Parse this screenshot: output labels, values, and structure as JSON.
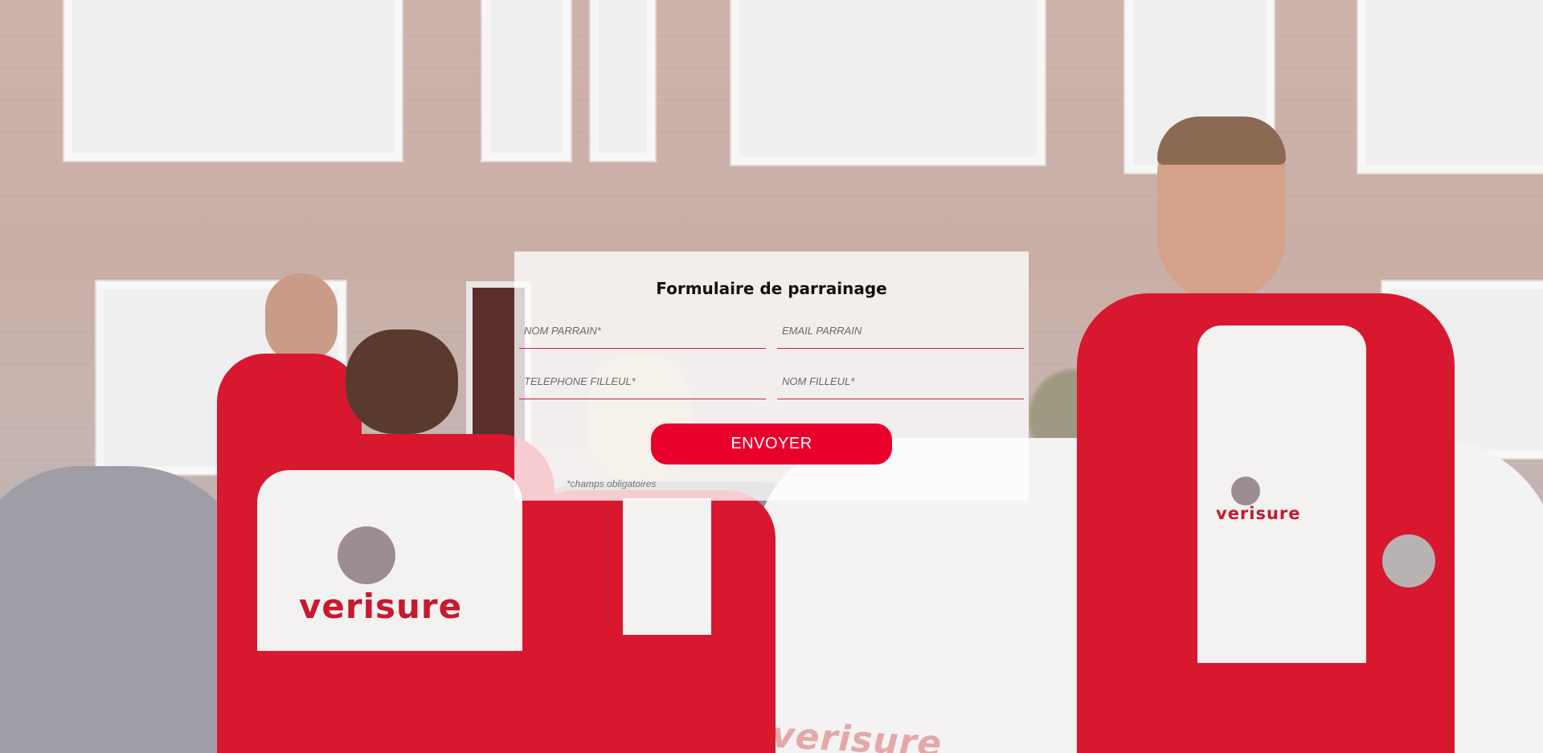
{
  "form": {
    "title": "Formulaire de parrainage",
    "fields": {
      "nom_parrain": {
        "placeholder": "NOM PARRAIN*",
        "value": ""
      },
      "email_parrain": {
        "placeholder": "EMAIL PARRAIN",
        "value": ""
      },
      "telephone_filleul": {
        "placeholder": "TELEPHONE FILLEUL*",
        "value": ""
      },
      "nom_filleul": {
        "placeholder": "NOM FILLEUL*",
        "value": ""
      }
    },
    "submit_label": "ENVOYER",
    "required_note": "*champs obligatoires"
  },
  "background": {
    "brand_texts": [
      "verisure",
      "verisure",
      "verisure"
    ],
    "colors": {
      "brand_red": "#e8002d",
      "jacket_red": "#d7182f",
      "field_underline": "#d31a3b"
    }
  }
}
